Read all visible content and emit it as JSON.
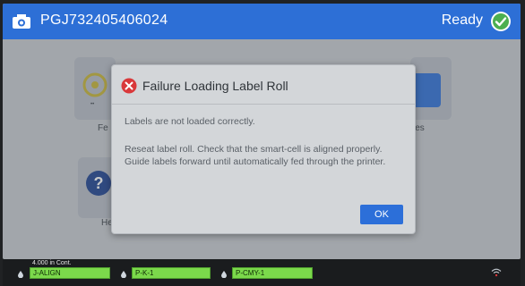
{
  "header": {
    "serial": "PGJ732405406024",
    "status": "Ready"
  },
  "background_tiles": {
    "left_top_label": "Fe",
    "right_top_label": "les",
    "left_bottom_label": "He",
    "left_top_sub": "••"
  },
  "dialog": {
    "title": "Failure Loading Label Roll",
    "message": "Labels are not loaded correctly.",
    "instructions": "Reseat label roll. Check that the smart-cell is aligned properly. Guide labels forward until automatically fed through the printer.",
    "ok_label": "OK"
  },
  "status_bar": {
    "media_info": "4.000 in Cont.",
    "slots": [
      {
        "label": "J-ALIGN"
      },
      {
        "label": "P-K-1"
      },
      {
        "label": "P-CMY-1"
      }
    ]
  },
  "colors": {
    "header": "#2d6fd6",
    "ok_button": "#2c6fd9",
    "ready_check": "#4caf50",
    "slot_green": "#7bd94b",
    "error_red": "#d9383a"
  }
}
